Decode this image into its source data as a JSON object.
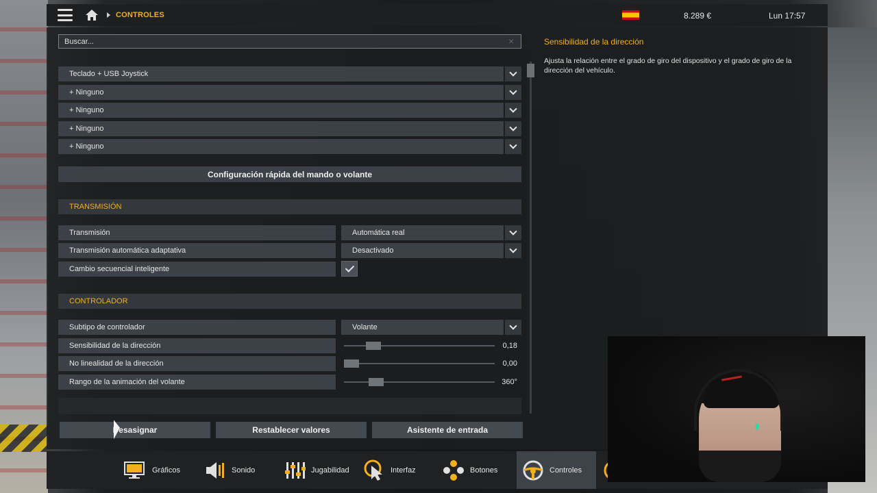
{
  "topbar": {
    "breadcrumb": "CONTROLES",
    "money": "8.289 €",
    "clock": "Lun 17:57"
  },
  "search": {
    "placeholder": "Buscar..."
  },
  "devices": {
    "primary": "Teclado + USB Joystick",
    "extra": [
      "+ Ninguno",
      "+ Ninguno",
      "+ Ninguno",
      "+ Ninguno"
    ]
  },
  "quick_setup_label": "Configuración rápida del mando o volante",
  "transmission": {
    "header": "TRANSMISIÓN",
    "rows": [
      {
        "label": "Transmisión",
        "value": "Automática real"
      },
      {
        "label": "Transmisión automática adaptativa",
        "value": "Desactivado"
      },
      {
        "label": "Cambio secuencial inteligente",
        "checked": true
      }
    ]
  },
  "controller": {
    "header": "CONTROLADOR",
    "subtype_label": "Subtipo de controlador",
    "subtype_value": "Volante",
    "sliders": [
      {
        "label": "Sensibilidad de la dirección",
        "value": "0,18",
        "fraction": 0.18
      },
      {
        "label": "No linealidad de la dirección",
        "value": "0,00",
        "fraction": 0.0
      },
      {
        "label": "Rango de la animación del volante",
        "value": "360°",
        "fraction": 0.2
      }
    ]
  },
  "actions": {
    "unassign": "Desasignar",
    "reset": "Restablecer valores",
    "wizard": "Asistente de entrada"
  },
  "info": {
    "title": "Sensibilidad de la dirección",
    "description": "Ajusta la relación entre el grado de giro del dispositivo y el grado de giro de la dirección del vehículo."
  },
  "nav": [
    {
      "label": "Gráficos",
      "icon": "monitor-icon"
    },
    {
      "label": "Sonido",
      "icon": "speaker-icon"
    },
    {
      "label": "Jugabilidad",
      "icon": "sliders-icon"
    },
    {
      "label": "Interfaz",
      "icon": "cursor-icon"
    },
    {
      "label": "Botones",
      "icon": "gamepad-buttons-icon"
    },
    {
      "label": "Controles",
      "icon": "steering-wheel-icon",
      "active": true
    }
  ],
  "colors": {
    "accent": "#f2b01e",
    "panel": "#1c1e20",
    "row": "#3b4146"
  }
}
